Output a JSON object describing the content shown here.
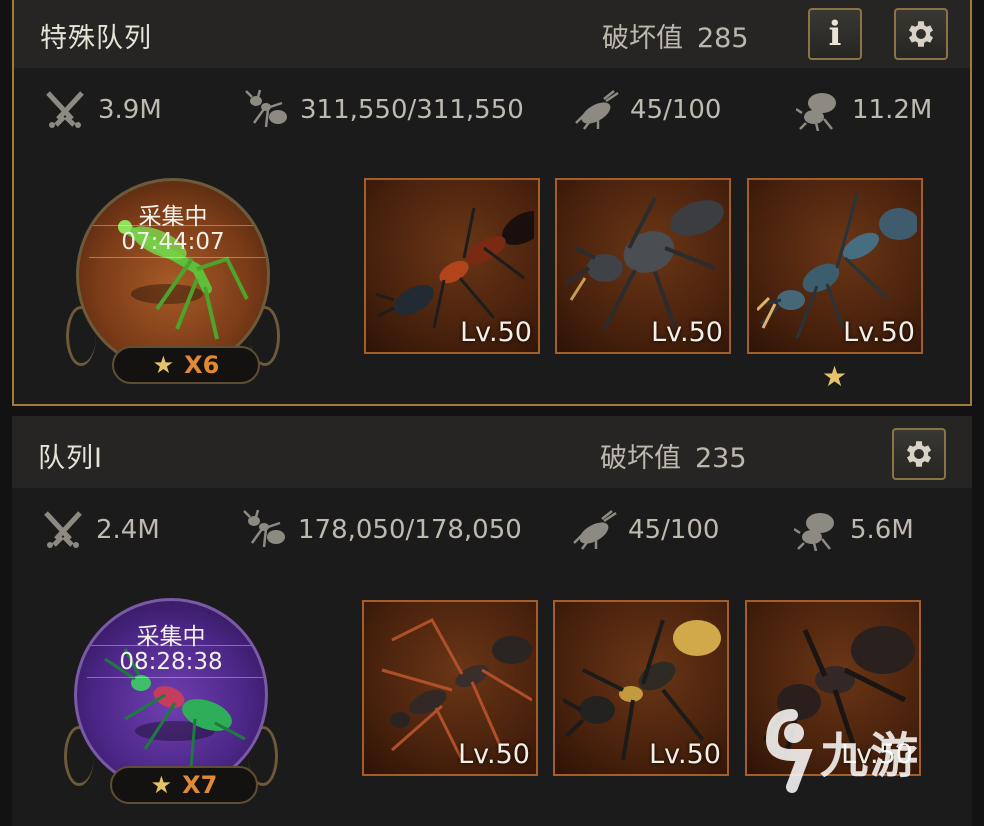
{
  "queues": [
    {
      "title": "特殊队列",
      "damage_label": "破坏值",
      "damage_value": "285",
      "has_info_button": true,
      "stats": {
        "attack": "3.9M",
        "troops": "311,550/311,550",
        "units": "45/100",
        "load": "11.2M"
      },
      "hero": {
        "status": "采集中",
        "timer": "07:44:07",
        "stars": "X6",
        "theme": "orange"
      },
      "ants": [
        {
          "level": "Lv.50",
          "icon": "red-black-ant"
        },
        {
          "level": "Lv.50",
          "icon": "gray-armored-ant"
        },
        {
          "level": "Lv.50",
          "icon": "blue-bull-ant",
          "star": "★"
        }
      ]
    },
    {
      "title": "队列I",
      "damage_label": "破坏值",
      "damage_value": "235",
      "has_info_button": false,
      "stats": {
        "attack": "2.4M",
        "troops": "178,050/178,050",
        "units": "45/100",
        "load": "5.6M"
      },
      "hero": {
        "status": "采集中",
        "timer": "08:28:38",
        "stars": "X7",
        "theme": "purple"
      },
      "ants": [
        {
          "level": "Lv.50",
          "icon": "long-legged-ant"
        },
        {
          "level": "Lv.50",
          "icon": "gold-abdomen-ant"
        },
        {
          "level": "Lv.50",
          "icon": "black-carpenter-ant"
        }
      ]
    }
  ],
  "watermark": "九游",
  "colors": {
    "gold_border": "#a17b3a",
    "stars_text": "#e08a37",
    "card_border": "#a45e2a"
  }
}
